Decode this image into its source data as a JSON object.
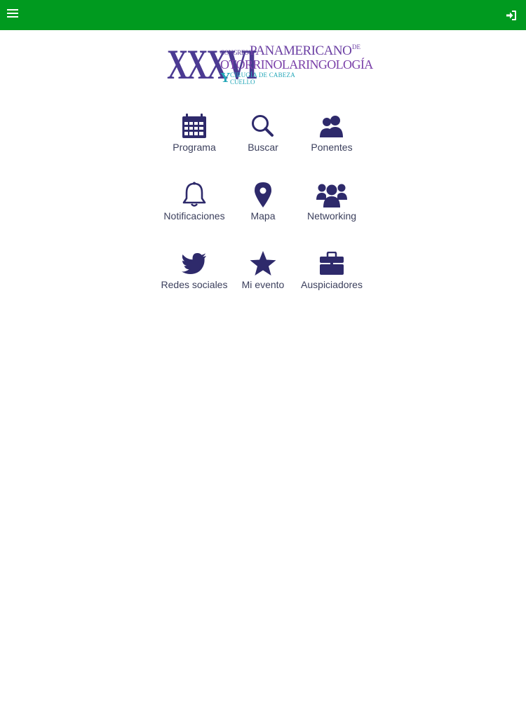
{
  "colors": {
    "topbar": "#009a1f",
    "icon": "#2e2a6b",
    "label": "#3b3f5c"
  },
  "logo": {
    "roman": "XXXVI",
    "congreso": "CONGRESO",
    "panamericano": "PANAMERICANO",
    "de": "DE",
    "otorrino": "OTORRINOLARINGOLOGÍA",
    "y": "Y",
    "cirugia": "CIRUGÍA DE CABEZA",
    "cuello": "CUELLO"
  },
  "topbar": {
    "menu_icon": "hamburger-menu-icon",
    "login_icon": "sign-in-icon"
  },
  "menu": [
    {
      "label": "Programa",
      "icon": "calendar-icon"
    },
    {
      "label": "Buscar",
      "icon": "search-icon"
    },
    {
      "label": "Ponentes",
      "icon": "users-icon"
    },
    {
      "label": "Notificaciones",
      "icon": "bell-icon"
    },
    {
      "label": "Mapa",
      "icon": "map-marker-icon"
    },
    {
      "label": "Networking",
      "icon": "group-icon"
    },
    {
      "label": "Redes sociales",
      "icon": "twitter-icon"
    },
    {
      "label": "Mi evento",
      "icon": "star-icon"
    },
    {
      "label": "Auspiciadores",
      "icon": "briefcase-icon"
    }
  ]
}
